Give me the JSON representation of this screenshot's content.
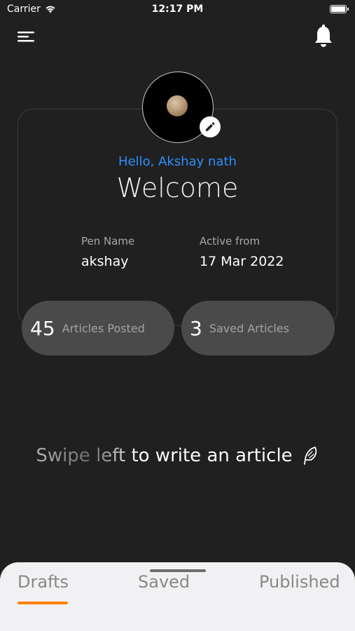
{
  "status_bar": {
    "carrier": "Carrier",
    "time": "12:17 PM"
  },
  "profile": {
    "greeting": "Hello, Akshay nath",
    "welcome": "Welcome",
    "pen_name_label": "Pen Name",
    "pen_name_value": "akshay",
    "active_from_label": "Active from",
    "active_from_value": "17 Mar 2022"
  },
  "stats": {
    "articles_posted_count": "45",
    "articles_posted_label": "Articles Posted",
    "saved_articles_count": "3",
    "saved_articles_label": "Saved Articles"
  },
  "hint": {
    "text": "Swipe left to write an article"
  },
  "bottom_tabs": [
    {
      "label": "Drafts"
    },
    {
      "label": "Saved"
    },
    {
      "label": "Published"
    }
  ],
  "colors": {
    "background": "#202020",
    "greeting": "#2e8fff",
    "active_tab_indicator": "#ff7f00",
    "stat_pill": "#4a4a4a"
  },
  "icons": [
    "wifi-icon",
    "battery-icon",
    "hamburger-menu-icon",
    "bell-icon",
    "pencil-icon",
    "feather-icon"
  ]
}
